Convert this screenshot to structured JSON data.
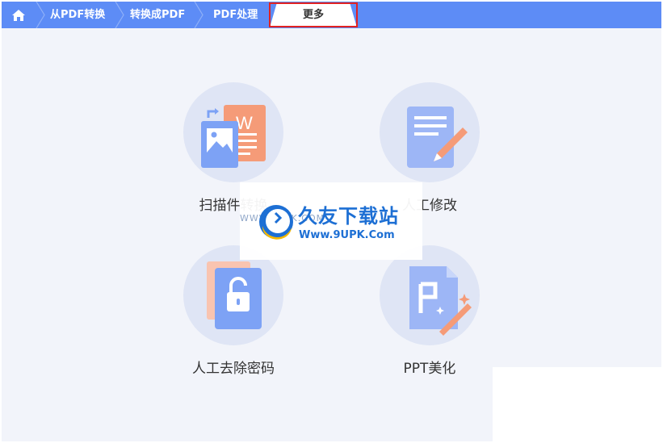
{
  "nav": {
    "tabs": [
      {
        "label": "从PDF转换"
      },
      {
        "label": "转换成PDF"
      },
      {
        "label": "PDF处理"
      }
    ],
    "active_tab": "更多"
  },
  "features": [
    {
      "label": "扫描件转换"
    },
    {
      "label": "人工修改"
    },
    {
      "label": "人工去除密码"
    },
    {
      "label": "PPT美化"
    }
  ],
  "watermark": {
    "title": "久友下载站",
    "url": "Www.9UPK.Com",
    "faint": "WWW.9UPK.COM"
  },
  "colors": {
    "nav_bg": "#5d8cf6",
    "active_outline": "#e12222",
    "accent_orange": "#f59b78",
    "accent_blue": "#7da2f5",
    "circle": "#dfe5f5"
  }
}
